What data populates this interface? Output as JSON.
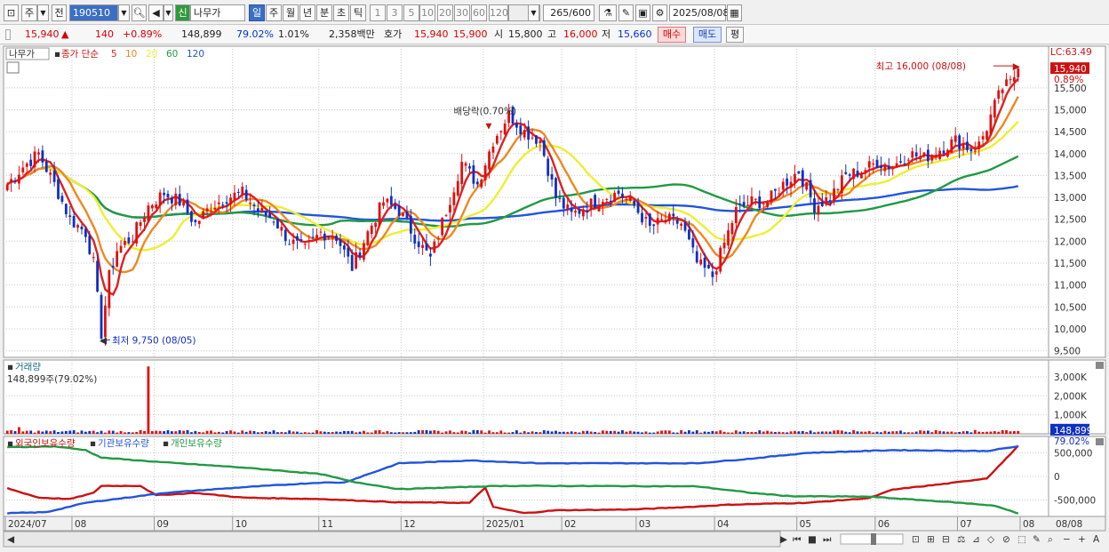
{
  "toolbar": {
    "period_unit": "주",
    "prev_label": "전",
    "code": "190510",
    "stock_badge": "신",
    "stock_name": "나무가",
    "period_tabs": [
      {
        "label": "일",
        "selected": true
      },
      {
        "label": "주",
        "selected": false
      },
      {
        "label": "월",
        "selected": false
      },
      {
        "label": "년",
        "selected": false
      },
      {
        "label": "분",
        "selected": false
      },
      {
        "label": "초",
        "selected": false
      },
      {
        "label": "틱",
        "selected": false
      }
    ],
    "interval_buttons": [
      "1",
      "3",
      "5",
      "10",
      "20",
      "30",
      "60",
      "120"
    ],
    "count": "265",
    "count_total": "/600",
    "date": "2025/08/08"
  },
  "info_bar": {
    "price": "15,940",
    "change": "140",
    "change_pct": "+0.89%",
    "volume": "148,899",
    "volume_ratio": "79.02%",
    "turnover": "1.01%",
    "amount": "2,358백만",
    "quote_label": "호가",
    "ask": "15,940",
    "bid": "15,900",
    "open_label": "시",
    "open": "15,800",
    "high_label": "고",
    "high": "16,000",
    "low_label": "저",
    "low": "15,660",
    "buy_label": "매수",
    "sell_label": "매도",
    "eval_label": "평"
  },
  "price_panel": {
    "stock_tag": "나무가",
    "legend": {
      "title": "종가 단순",
      "ma": [
        {
          "label": "5",
          "color": "#dd2222"
        },
        {
          "label": "10",
          "color": "#ee8822"
        },
        {
          "label": "20",
          "color": "#eeee33"
        },
        {
          "label": "60",
          "color": "#229944"
        },
        {
          "label": "120",
          "color": "#2255dd"
        }
      ]
    },
    "lc_label": "LC:63.49",
    "price_badge": "15,940",
    "change_badge": "0.89%",
    "max_note": "최고 16,000 (08/08)",
    "min_note": "최저 9,750 (08/05)",
    "event_note": "배당락(0.70%)"
  },
  "volume_panel": {
    "title": "거래량",
    "value_note": "148,899주(79.02%)",
    "badge_value": "148,899",
    "badge_pct": "79.02%"
  },
  "holdings_panel": {
    "legend": [
      {
        "label": "외국인보유수량",
        "color": "#cc1111"
      },
      {
        "label": "기관보유수량",
        "color": "#2255dd"
      },
      {
        "label": "개인보유수량",
        "color": "#229944"
      }
    ]
  },
  "x_axis": {
    "labels": [
      "2024/07",
      "08",
      "09",
      "10",
      "11",
      "12",
      "2025/01",
      "02",
      "03",
      "04",
      "05",
      "06",
      "07",
      "08"
    ],
    "right_label": "08/08"
  },
  "chart_data": [
    {
      "type": "candlestick",
      "title": "",
      "y_ticks": [
        9500,
        10000,
        10500,
        11000,
        11500,
        12000,
        12500,
        13000,
        13500,
        14000,
        14500,
        15000,
        15500
      ],
      "ylim": [
        9350,
        16450
      ],
      "x_months": [
        "2024/07",
        "2024/08",
        "2024/09",
        "2024/10",
        "2024/11",
        "2024/12",
        "2025/01",
        "2025/02",
        "2025/03",
        "2025/04",
        "2025/05",
        "2025/06",
        "2025/07",
        "2025/08"
      ],
      "close_path": [
        [
          0,
          13300
        ],
        [
          4,
          13700
        ],
        [
          8,
          14000
        ],
        [
          12,
          13300
        ],
        [
          16,
          12500
        ],
        [
          20,
          12200
        ],
        [
          22,
          11500
        ],
        [
          24,
          9900
        ],
        [
          26,
          11200
        ],
        [
          28,
          11800
        ],
        [
          32,
          12100
        ],
        [
          36,
          12800
        ],
        [
          40,
          13100
        ],
        [
          44,
          12900
        ],
        [
          48,
          12400
        ],
        [
          52,
          12800
        ],
        [
          56,
          13000
        ],
        [
          60,
          13100
        ],
        [
          64,
          12700
        ],
        [
          68,
          12500
        ],
        [
          72,
          12000
        ],
        [
          76,
          11800
        ],
        [
          80,
          12200
        ],
        [
          84,
          12100
        ],
        [
          88,
          11400
        ],
        [
          92,
          12200
        ],
        [
          96,
          12900
        ],
        [
          100,
          12700
        ],
        [
          104,
          12100
        ],
        [
          108,
          11600
        ],
        [
          112,
          12700
        ],
        [
          116,
          13800
        ],
        [
          120,
          13300
        ],
        [
          124,
          14300
        ],
        [
          128,
          14900
        ],
        [
          132,
          14500
        ],
        [
          136,
          14300
        ],
        [
          140,
          13000
        ],
        [
          144,
          12600
        ],
        [
          148,
          12800
        ],
        [
          152,
          13000
        ],
        [
          156,
          13100
        ],
        [
          160,
          12800
        ],
        [
          164,
          12300
        ],
        [
          168,
          12500
        ],
        [
          172,
          12400
        ],
        [
          176,
          11500
        ],
        [
          180,
          11200
        ],
        [
          182,
          11700
        ],
        [
          186,
          12700
        ],
        [
          190,
          12900
        ],
        [
          194,
          12900
        ],
        [
          198,
          13300
        ],
        [
          202,
          13600
        ],
        [
          206,
          12800
        ],
        [
          210,
          13000
        ],
        [
          214,
          13500
        ],
        [
          218,
          13600
        ],
        [
          222,
          13800
        ],
        [
          226,
          13700
        ],
        [
          230,
          14000
        ],
        [
          234,
          13900
        ],
        [
          238,
          14100
        ],
        [
          242,
          14300
        ],
        [
          246,
          14100
        ],
        [
          248,
          14200
        ],
        [
          250,
          14600
        ],
        [
          252,
          15100
        ],
        [
          254,
          15500
        ],
        [
          256,
          15600
        ],
        [
          258,
          15940
        ]
      ],
      "min_point": {
        "i": 24,
        "value": 9750,
        "label": "최저 9,750 (08/05)"
      },
      "max_point": {
        "i": 258,
        "value": 16000,
        "label": "최고 16,000 (08/08)"
      },
      "event": {
        "i": 123,
        "label": "배당락(0.70%)"
      },
      "moving_averages": [
        {
          "name": "5",
          "color": "#dd2222",
          "window": 5
        },
        {
          "name": "10",
          "color": "#ee8822",
          "window": 10
        },
        {
          "name": "20",
          "color": "#eeee33",
          "window": 20
        },
        {
          "name": "60",
          "color": "#229944",
          "window": 60
        },
        {
          "name": "120",
          "color": "#2255dd",
          "window": 120
        }
      ],
      "last_close": 15940
    },
    {
      "type": "bar",
      "title": "거래량",
      "y_ticks": [
        1000000,
        2000000,
        3000000
      ],
      "y_tick_labels": [
        "1,000K",
        "2,000K",
        "3,000K"
      ],
      "ylim": [
        0,
        3700000
      ],
      "typical_volume": 150000,
      "spikes": [
        {
          "i": 3,
          "value": 350000
        },
        {
          "i": 36,
          "value": 3550000
        },
        {
          "i": 119,
          "value": 200000
        },
        {
          "i": 186,
          "value": 180000
        },
        {
          "i": 247,
          "value": 200000
        },
        {
          "i": 258,
          "value": 148899
        }
      ]
    },
    {
      "type": "line",
      "title": "",
      "y_ticks": [
        -500000,
        0,
        500000
      ],
      "y_tick_labels": [
        "-500,000",
        "0",
        "500,000"
      ],
      "ylim": [
        -850000,
        850000
      ],
      "series": [
        {
          "name": "외국인보유수량",
          "color": "#cc1111",
          "points": [
            [
              0,
              -250000
            ],
            [
              8,
              -450000
            ],
            [
              16,
              -480000
            ],
            [
              22,
              -350000
            ],
            [
              24,
              -200000
            ],
            [
              34,
              -200000
            ],
            [
              38,
              -400000
            ],
            [
              48,
              -350000
            ],
            [
              60,
              -450000
            ],
            [
              80,
              -480000
            ],
            [
              100,
              -550000
            ],
            [
              118,
              -560000
            ],
            [
              122,
              -230000
            ],
            [
              124,
              -650000
            ],
            [
              132,
              -780000
            ],
            [
              140,
              -720000
            ],
            [
              160,
              -700000
            ],
            [
              176,
              -640000
            ],
            [
              184,
              -600000
            ],
            [
              204,
              -560000
            ],
            [
              220,
              -460000
            ],
            [
              226,
              -280000
            ],
            [
              240,
              -150000
            ],
            [
              250,
              -40000
            ],
            [
              254,
              300000
            ],
            [
              258,
              650000
            ]
          ]
        },
        {
          "name": "기관보유수량",
          "color": "#2255dd",
          "points": [
            [
              0,
              -780000
            ],
            [
              10,
              -760000
            ],
            [
              20,
              -560000
            ],
            [
              40,
              -350000
            ],
            [
              60,
              -230000
            ],
            [
              80,
              -130000
            ],
            [
              86,
              -130000
            ],
            [
              100,
              280000
            ],
            [
              118,
              340000
            ],
            [
              136,
              280000
            ],
            [
              176,
              280000
            ],
            [
              190,
              380000
            ],
            [
              204,
              500000
            ],
            [
              226,
              560000
            ],
            [
              250,
              540000
            ],
            [
              258,
              640000
            ]
          ]
        },
        {
          "name": "개인보유수량",
          "color": "#229944",
          "points": [
            [
              0,
              620000
            ],
            [
              12,
              640000
            ],
            [
              20,
              560000
            ],
            [
              24,
              400000
            ],
            [
              40,
              300000
            ],
            [
              60,
              190000
            ],
            [
              80,
              50000
            ],
            [
              88,
              -110000
            ],
            [
              100,
              -270000
            ],
            [
              126,
              -200000
            ],
            [
              136,
              -200000
            ],
            [
              176,
              -210000
            ],
            [
              190,
              -350000
            ],
            [
              200,
              -420000
            ],
            [
              220,
              -430000
            ],
            [
              240,
              -540000
            ],
            [
              252,
              -620000
            ],
            [
              258,
              -790000
            ]
          ]
        }
      ]
    }
  ]
}
